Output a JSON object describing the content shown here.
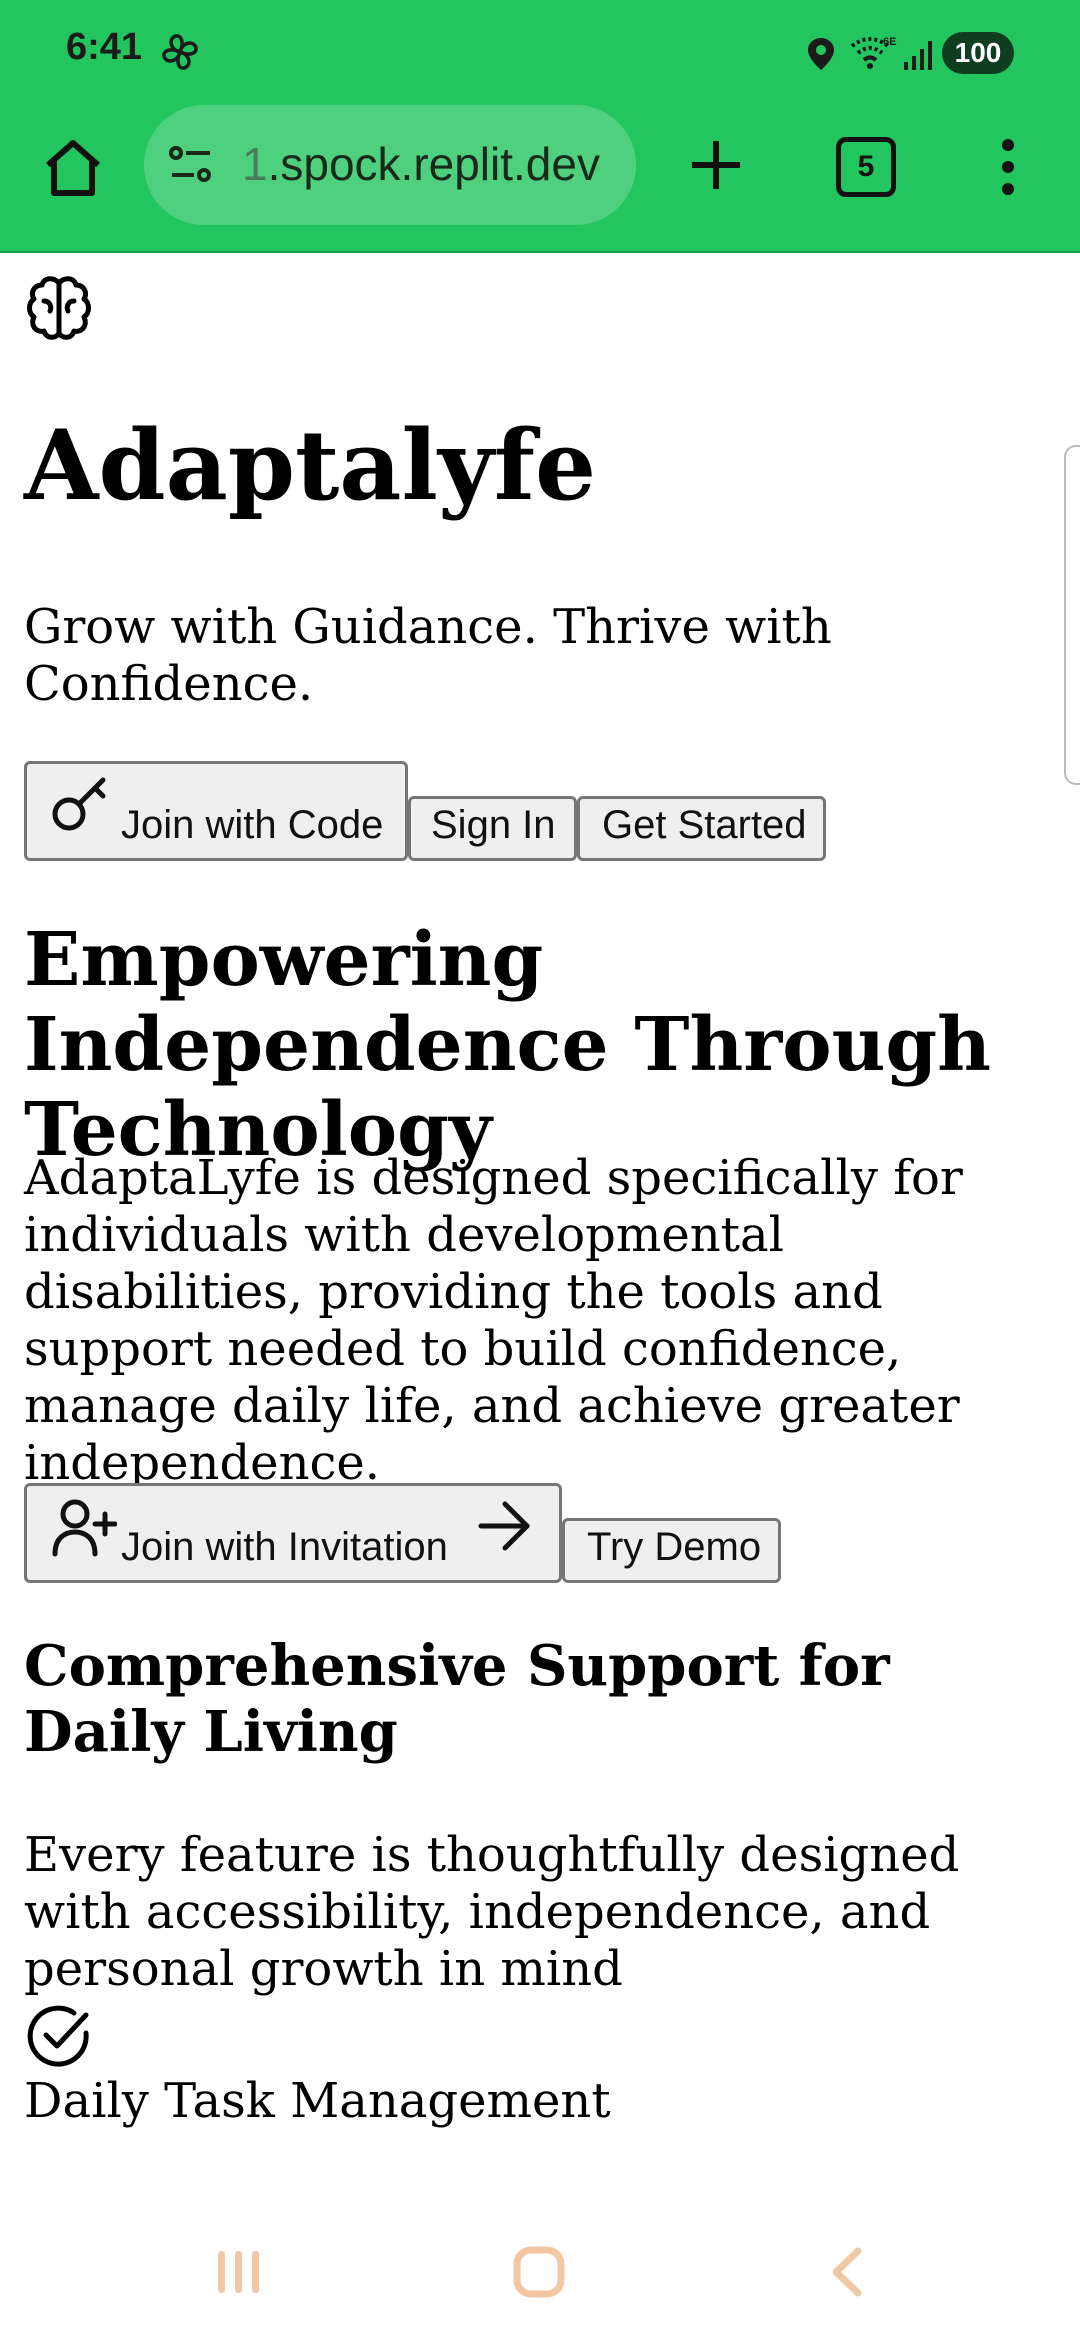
{
  "status_bar": {
    "time": "6:41",
    "battery": "100",
    "icons": [
      "fan-icon",
      "location-icon",
      "wifi-6e-icon",
      "signal-icon",
      "battery-icon"
    ]
  },
  "browser": {
    "url_prefix": "1",
    "url_main": ".spock.replit.dev",
    "tab_count": "5",
    "accent_color": "#22c55e"
  },
  "page": {
    "logo_icon": "brain-icon",
    "title": "Adaptalyfe",
    "tagline": "Grow with Guidance. Thrive with Confidence.",
    "top_buttons": {
      "join_code": "Join with Code",
      "sign_in": "Sign In",
      "get_started": "Get Started"
    },
    "hero_heading": "Empowering Independence Through Technology",
    "hero_description": "AdaptaLyfe is designed specifically for individuals with developmental disabilities, providing the tools and support needed to build confidence, manage daily life, and achieve greater independence.",
    "hero_buttons": {
      "join_invitation": "Join with Invitation",
      "try_demo": "Try Demo"
    },
    "section_heading": "Comprehensive Support for Daily Living",
    "section_description": "Every feature is thoughtfully designed with accessibility, independence, and personal growth in mind",
    "features": [
      {
        "icon": "check-circle-icon",
        "title": "Daily Task Management"
      }
    ]
  }
}
